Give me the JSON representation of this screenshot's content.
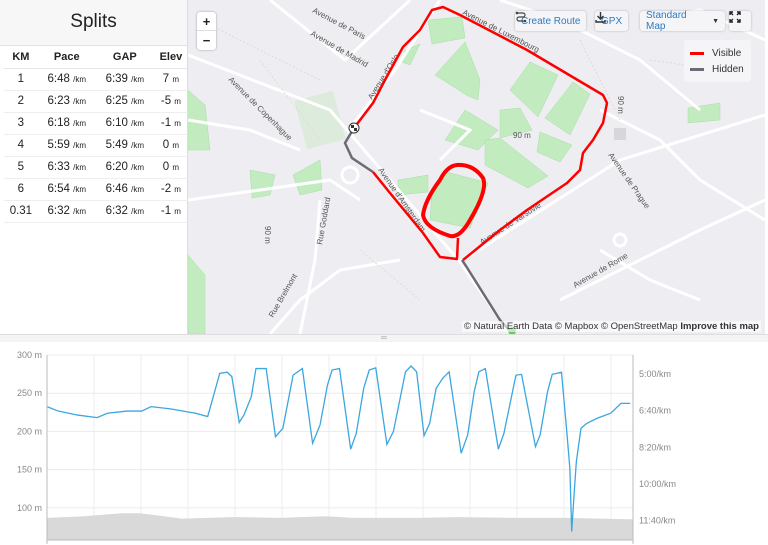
{
  "splits": {
    "title": "Splits",
    "columns": [
      "KM",
      "Pace",
      "GAP",
      "Elev"
    ],
    "pace_unit": "/km",
    "elev_unit": "m",
    "rows": [
      {
        "km": "1",
        "pace": "6:48",
        "gap": "6:39",
        "elev": "7"
      },
      {
        "km": "2",
        "pace": "6:23",
        "gap": "6:25",
        "elev": "-5"
      },
      {
        "km": "3",
        "pace": "6:18",
        "gap": "6:10",
        "elev": "-1"
      },
      {
        "km": "4",
        "pace": "5:59",
        "gap": "5:49",
        "elev": "0"
      },
      {
        "km": "5",
        "pace": "6:33",
        "gap": "6:20",
        "elev": "0"
      },
      {
        "km": "6",
        "pace": "6:54",
        "gap": "6:46",
        "elev": "-2"
      },
      {
        "km": "0.31",
        "pace": "6:32",
        "gap": "6:32",
        "elev": "-1"
      }
    ]
  },
  "map": {
    "zoom_in": "+",
    "zoom_out": "−",
    "create_route": "Create Route",
    "gpx": "GPX",
    "map_style": "Standard Map",
    "legend": [
      {
        "label": "Visible",
        "color": "#ff0000"
      },
      {
        "label": "Hidden",
        "color": "#6b6b76"
      }
    ],
    "streets": [
      "Avenue de Paris",
      "Avenue de Madrid",
      "Avenue de Copenhague",
      "Avenue d'Oslo",
      "Avenue de Luxembourg",
      "Avenue d'Amsterdam",
      "Avenue de Varsovie",
      "Avenue de Rome",
      "Avenue de Prague",
      "Rue Goddard",
      "Rue Brelmont"
    ],
    "elev_labels": [
      "90 m",
      "90 m",
      "90 m"
    ],
    "attribution": "© Natural Earth Data © Mapbox © OpenStreetMap",
    "improve": "Improve this map",
    "colors": {
      "route": "#ff0000",
      "hidden": "#6b6b76",
      "park": "#c2ecc0",
      "road": "#ffffff",
      "land": "#eeeef2"
    }
  },
  "chart_data": {
    "type": "line",
    "left_axis": {
      "ticks": [
        "300 m",
        "250 m",
        "200 m",
        "150 m",
        "100 m"
      ],
      "range": [
        58,
        300
      ],
      "unit": "m"
    },
    "right_axis": {
      "ticks": [
        "5:00/km",
        "6:40/km",
        "8:20/km",
        "10:00/km",
        "11:40/km"
      ],
      "range_seconds": [
        248,
        753
      ],
      "reversed": false
    },
    "x_range_km": [
      0,
      6.31
    ],
    "grid": true,
    "series": [
      {
        "kind": "pace",
        "color": "#3aa7e0",
        "unit": "s/km",
        "points": [
          [
            0,
            389
          ],
          [
            0.12,
            401
          ],
          [
            0.33,
            412
          ],
          [
            0.54,
            419
          ],
          [
            0.65,
            407
          ],
          [
            0.86,
            401
          ],
          [
            1.02,
            401
          ],
          [
            1.12,
            389
          ],
          [
            1.33,
            395
          ],
          [
            1.6,
            407
          ],
          [
            1.73,
            416
          ],
          [
            1.78,
            371
          ],
          [
            1.86,
            298
          ],
          [
            1.94,
            295
          ],
          [
            1.99,
            307
          ],
          [
            2.07,
            432
          ],
          [
            2.12,
            412
          ],
          [
            2.2,
            362
          ],
          [
            2.25,
            285
          ],
          [
            2.36,
            285
          ],
          [
            2.46,
            471
          ],
          [
            2.54,
            448
          ],
          [
            2.65,
            303
          ],
          [
            2.75,
            285
          ],
          [
            2.86,
            489
          ],
          [
            2.94,
            439
          ],
          [
            3.02,
            330
          ],
          [
            3.07,
            289
          ],
          [
            3.15,
            285
          ],
          [
            3.27,
            505
          ],
          [
            3.33,
            462
          ],
          [
            3.41,
            339
          ],
          [
            3.47,
            289
          ],
          [
            3.54,
            283
          ],
          [
            3.66,
            492
          ],
          [
            3.73,
            457
          ],
          [
            3.81,
            357
          ],
          [
            3.86,
            294
          ],
          [
            3.92,
            278
          ],
          [
            3.98,
            294
          ],
          [
            4.06,
            468
          ],
          [
            4.12,
            435
          ],
          [
            4.19,
            339
          ],
          [
            4.26,
            312
          ],
          [
            4.33,
            294
          ],
          [
            4.46,
            516
          ],
          [
            4.53,
            466
          ],
          [
            4.6,
            348
          ],
          [
            4.65,
            294
          ],
          [
            4.72,
            285
          ],
          [
            4.86,
            505
          ],
          [
            4.92,
            462
          ],
          [
            5.02,
            339
          ],
          [
            5.05,
            303
          ],
          [
            5.11,
            301
          ],
          [
            5.26,
            498
          ],
          [
            5.31,
            466
          ],
          [
            5.39,
            348
          ],
          [
            5.44,
            301
          ],
          [
            5.54,
            295
          ],
          [
            5.6,
            466
          ],
          [
            5.63,
            557
          ],
          [
            5.65,
            730
          ],
          [
            5.68,
            612
          ],
          [
            5.7,
            539
          ],
          [
            5.75,
            448
          ],
          [
            5.81,
            435
          ],
          [
            5.92,
            421
          ],
          [
            6.07,
            407
          ],
          [
            6.18,
            380
          ],
          [
            6.28,
            380
          ]
        ]
      },
      {
        "kind": "elevation",
        "color": "#d9d9d9",
        "unit": "m",
        "points": [
          [
            0,
            87
          ],
          [
            0.4,
            89
          ],
          [
            0.8,
            93
          ],
          [
            1.0,
            93
          ],
          [
            1.2,
            90
          ],
          [
            1.45,
            86
          ],
          [
            2.0,
            88
          ],
          [
            2.5,
            87
          ],
          [
            3.0,
            89
          ],
          [
            3.3,
            87
          ],
          [
            4.0,
            87
          ],
          [
            4.4,
            88
          ],
          [
            5.0,
            87
          ],
          [
            5.6,
            87
          ],
          [
            6.31,
            85
          ]
        ]
      }
    ]
  }
}
